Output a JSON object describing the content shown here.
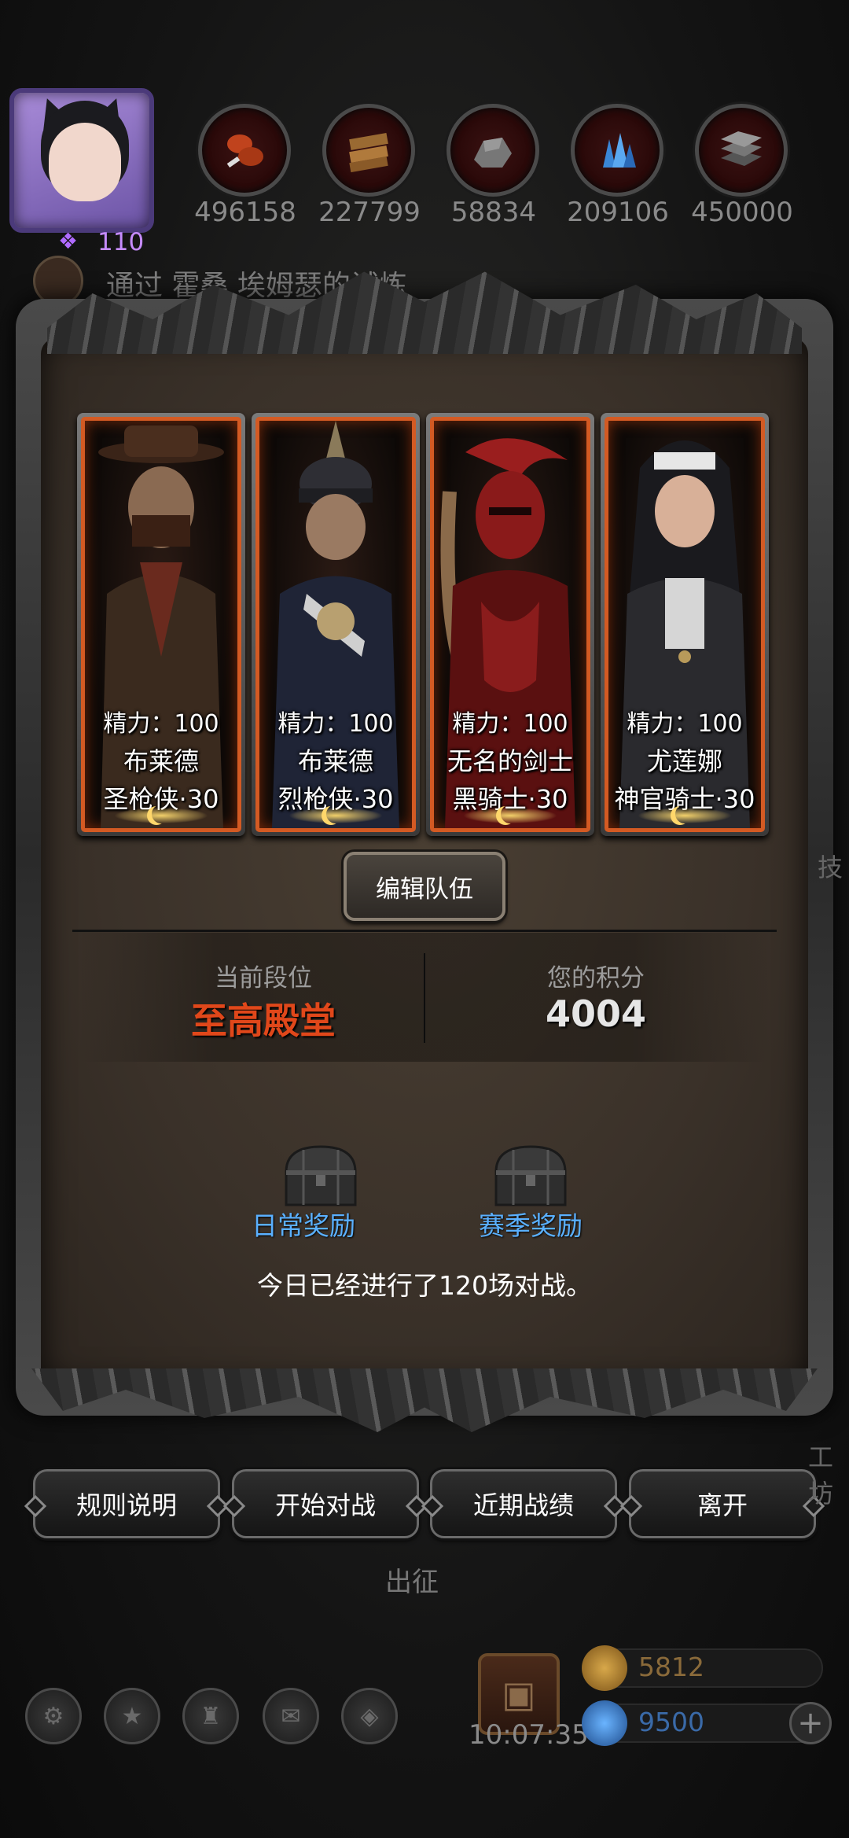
{
  "player": {
    "level": "110"
  },
  "resources": [
    {
      "icon": "meat-icon",
      "value": "496158",
      "color": "#c0431d"
    },
    {
      "icon": "wood-icon",
      "value": "227799",
      "color": "#9a6a32"
    },
    {
      "icon": "stone-icon",
      "value": "58834",
      "color": "#777777"
    },
    {
      "icon": "crystal-icon",
      "value": "209106",
      "color": "#3a86d6"
    },
    {
      "icon": "iron-icon",
      "value": "450000",
      "color": "#555555"
    }
  ],
  "quest": {
    "text": "通过 霍桑 埃姆瑟的试炼"
  },
  "heroes": [
    {
      "energy": "精力：100",
      "name": "布莱德",
      "class": "圣枪侠·30"
    },
    {
      "energy": "精力：100",
      "name": "布莱德",
      "class": "烈枪侠·30"
    },
    {
      "energy": "精力：100",
      "name": "无名的剑士",
      "class": "黑骑士·30"
    },
    {
      "energy": "精力：100",
      "name": "尤莲娜",
      "class": "神官骑士·30"
    }
  ],
  "edit_team_label": "编辑队伍",
  "rank": {
    "label": "当前段位",
    "value": "至高殿堂"
  },
  "score": {
    "label": "您的积分",
    "value": "4004"
  },
  "rewards": {
    "daily_label": "日常奖励",
    "season_label": "赛季奖励"
  },
  "battle_count_text": "今日已经进行了120场对战。",
  "bottom_buttons": {
    "rules": "规则说明",
    "start": "开始对战",
    "records": "近期战绩",
    "leave": "离开"
  },
  "expedition_label": "出征",
  "timer": "10:07:35",
  "currency": {
    "gold": "5812",
    "gems": "9500"
  },
  "side_text": {
    "right_top": "技",
    "right_bottom": "工坊"
  },
  "colors": {
    "accent_orange": "#d35a23",
    "rank_red": "#e0471a",
    "reward_blue": "#5ab0ff"
  }
}
